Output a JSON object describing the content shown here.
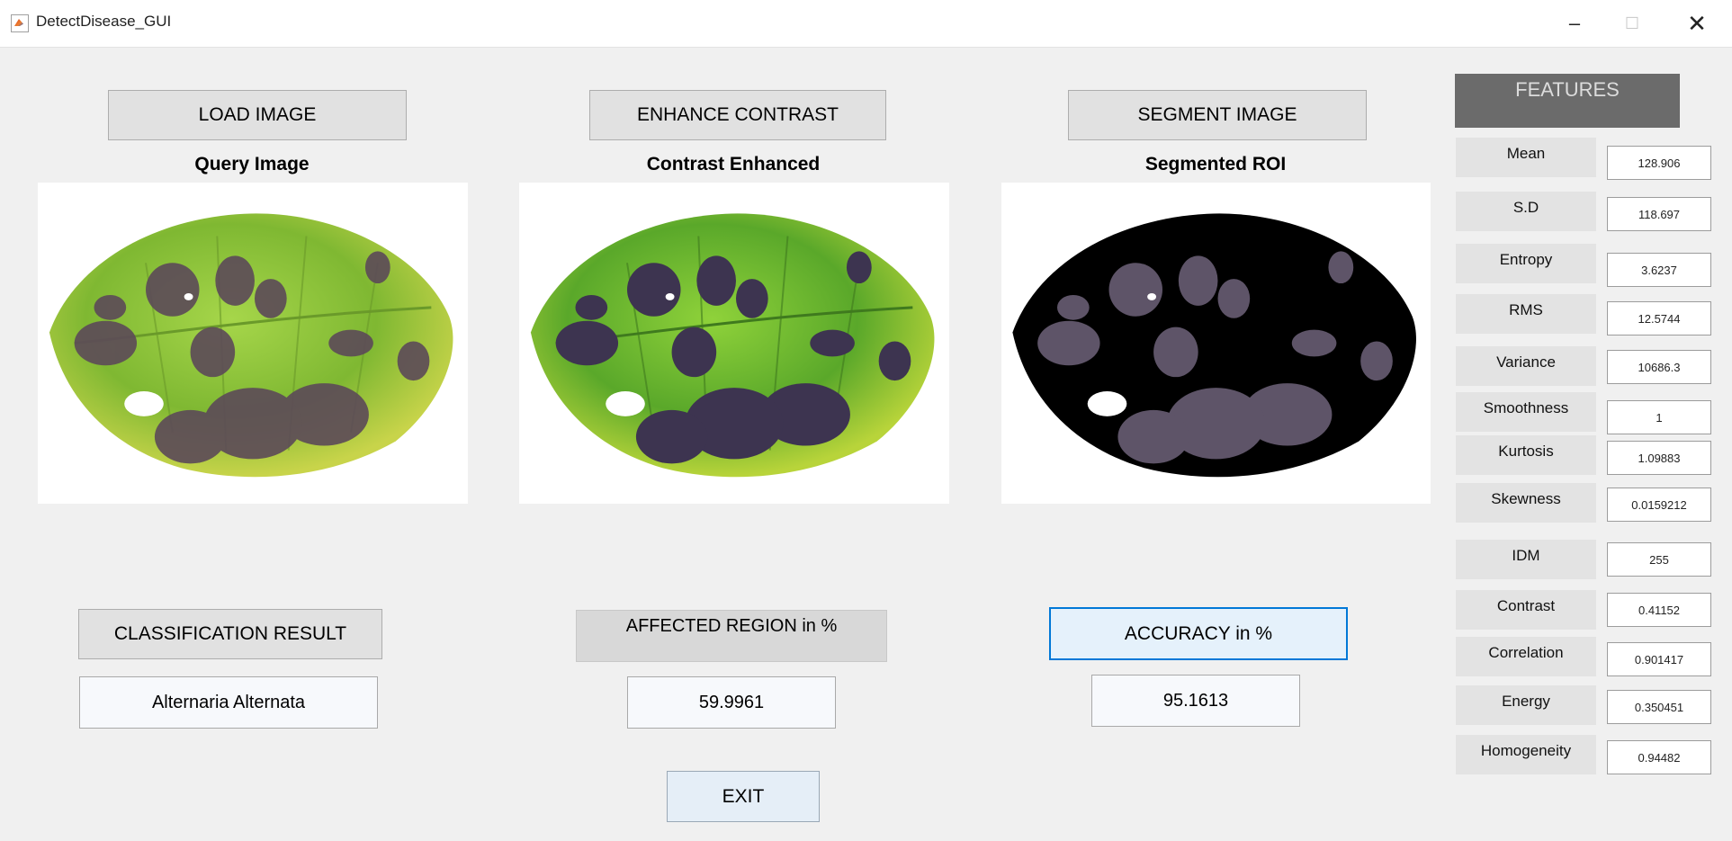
{
  "window": {
    "title": "DetectDisease_GUI",
    "minimize": "–",
    "maximize": "☐",
    "close": "✕"
  },
  "buttons": {
    "load": "LOAD IMAGE",
    "enhance": "ENHANCE CONTRAST",
    "segment": "SEGMENT IMAGE",
    "classification": "CLASSIFICATION RESULT",
    "accuracy": "ACCURACY in %",
    "exit": "EXIT"
  },
  "panels": {
    "query_caption": "Query Image",
    "enhanced_caption": "Contrast Enhanced",
    "segmented_caption": "Segmented ROI"
  },
  "results": {
    "affected_label": "AFFECTED REGION in %",
    "classification_value": "Alternaria Alternata",
    "affected_value": "59.9961",
    "accuracy_value": "95.1613"
  },
  "features": {
    "header": "FEATURES",
    "items": [
      {
        "label": "Mean",
        "value": "128.906"
      },
      {
        "label": "S.D",
        "value": "118.697"
      },
      {
        "label": "Entropy",
        "value": "3.6237"
      },
      {
        "label": "RMS",
        "value": "12.5744"
      },
      {
        "label": "Variance",
        "value": "10686.3"
      },
      {
        "label": "Smoothness",
        "value": "1"
      },
      {
        "label": "Kurtosis",
        "value": "1.09883"
      },
      {
        "label": "Skewness",
        "value": "0.0159212"
      },
      {
        "label": "IDM",
        "value": "255"
      },
      {
        "label": "Contrast",
        "value": "0.41152"
      },
      {
        "label": "Correlation",
        "value": "0.901417"
      },
      {
        "label": "Energy",
        "value": "0.350451"
      },
      {
        "label": "Homogeneity",
        "value": "0.94482"
      }
    ]
  },
  "colors": {
    "leaf_green": "#8cc43a",
    "leaf_dark_green": "#4e8a24",
    "lesion": "#5c4a58",
    "accent_focus": "#0078d7"
  }
}
